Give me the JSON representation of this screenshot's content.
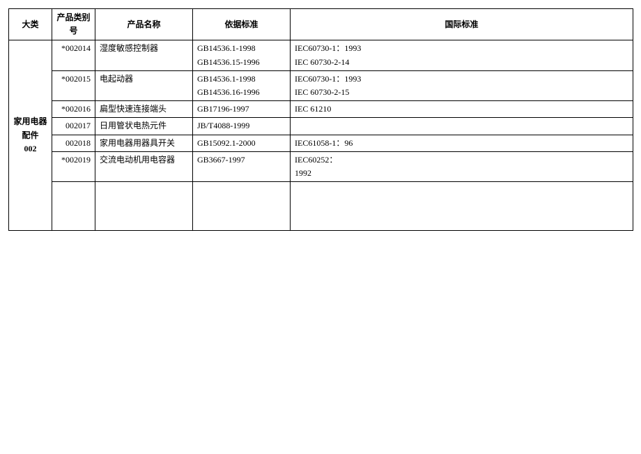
{
  "headers": {
    "category": "大类",
    "product_num": "产品类别号",
    "product_name": "产品名称",
    "basis_standard": "依据标准",
    "intl_standard": "国际标准"
  },
  "category_label": "家用电器\n配件\n002",
  "rows": [
    {
      "num": "*002014",
      "name": "湿度敏感控制器",
      "std": "GB14536.1-1998\nGB14536.15-1996",
      "intl": "IEC60730-1：1993\nIEC 60730-2-14"
    },
    {
      "num": "*002015",
      "name": "电起动器",
      "std": "GB14536.1-1998\nGB14536.16-1996",
      "intl": "IEC60730-1：1993\nIEC 60730-2-15"
    },
    {
      "num": "*002016",
      "name": "扁型快速连接端头",
      "std": "GB17196-1997",
      "intl": "IEC 61210"
    },
    {
      "num": "002017",
      "name": "日用管状电热元件",
      "std": "JB/T4088-1999",
      "intl": ""
    },
    {
      "num": "002018",
      "name": "家用电器用器具开关",
      "std": "GB15092.1-2000",
      "intl": "IEC61058-1：96"
    },
    {
      "num": "*002019",
      "name": "交流电动机用电容器",
      "std": "GB3667-1997",
      "intl": "IEC60252：\n1992"
    }
  ]
}
